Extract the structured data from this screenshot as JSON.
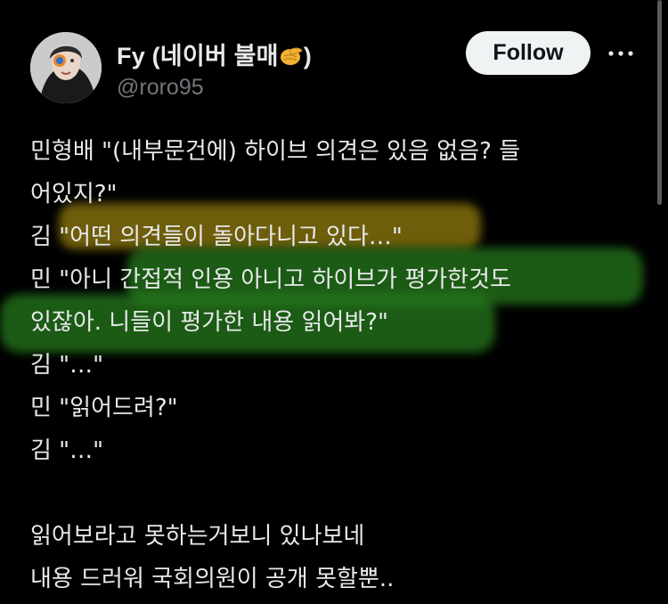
{
  "author": {
    "display_name": "Fy (네이버 불매",
    "display_name_suffix": ")",
    "emoji": "pinching-hand-emoji",
    "handle": "@roro95"
  },
  "actions": {
    "follow_label": "Follow",
    "more_icon": "more-horizontal-icon"
  },
  "tweet": {
    "lines": [
      "민형배 \"(내부문건에) 하이브 의견은 있음 없음? 들",
      "어있지?\"",
      "김 \"어떤 의견들이 돌아다니고 있다…\"",
      "민 \"아니 간접적 인용 아니고 하이브가 평가한것도",
      "있잖아. 니들이 평가한 내용 읽어봐?\"",
      "김 \"…\"",
      "민 \"읽어드려?\"",
      "김 \"…\"",
      "",
      "읽어보라고 못하는거보니 있나보네",
      "내용 드러워 국회의원이 공개 못할뿐.."
    ]
  },
  "highlights": {
    "yellow": "#c8aa14",
    "green": "#28821e"
  },
  "colors": {
    "background": "#000000",
    "text": "#e7e9ea",
    "muted": "#71767b",
    "button_bg": "#eff3f4"
  }
}
